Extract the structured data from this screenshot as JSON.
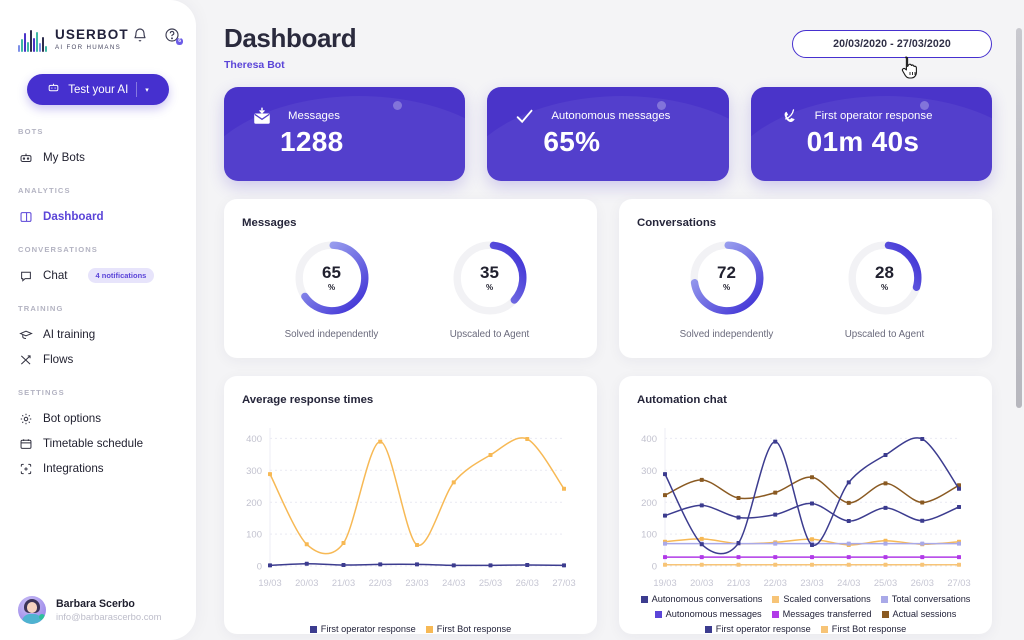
{
  "brand": {
    "name": "USERBOT",
    "tagline": "AI FOR HUMANS"
  },
  "header_icons": [
    {
      "name": "bell-icon",
      "badge": ""
    },
    {
      "name": "help-icon",
      "badge": "6"
    }
  ],
  "test_button": {
    "label": "Test your AI",
    "caret": "▾",
    "icon": "bot-icon"
  },
  "sidebar": {
    "groups": [
      {
        "title": "BOTS",
        "items": [
          {
            "label": "My Bots",
            "icon": "robot-icon",
            "active": false,
            "badge": ""
          }
        ]
      },
      {
        "title": "ANALYTICS",
        "items": [
          {
            "label": "Dashboard",
            "icon": "layout-icon",
            "active": true,
            "badge": ""
          }
        ]
      },
      {
        "title": "CONVERSATIONS",
        "items": [
          {
            "label": "Chat",
            "icon": "chat-bubble-icon",
            "active": false,
            "badge": "4 notifications"
          }
        ]
      },
      {
        "title": "TRAINING",
        "items": [
          {
            "label": "AI training",
            "icon": "graduation-cap-icon",
            "active": false,
            "badge": ""
          },
          {
            "label": "Flows",
            "icon": "flow-arrows-icon",
            "active": false,
            "badge": ""
          }
        ]
      },
      {
        "title": "SETTINGS",
        "items": [
          {
            "label": "Bot options",
            "icon": "gear-icon",
            "active": false,
            "badge": ""
          },
          {
            "label": "Timetable schedule",
            "icon": "calendar-icon",
            "active": false,
            "badge": ""
          },
          {
            "label": "Integrations",
            "icon": "puzzle-plus-icon",
            "active": false,
            "badge": ""
          }
        ]
      }
    ]
  },
  "user": {
    "name": "Barbara Scerbo",
    "email": "info@barbarascerbo.com",
    "avatar": "user-avatar"
  },
  "page": {
    "title": "Dashboard",
    "subtitle": "Theresa Bot"
  },
  "date_range": {
    "value": "20/03/2020 - 27/03/2020"
  },
  "kpis": [
    {
      "label": "Messages",
      "value": "1288",
      "icon": "mail-inbox-icon"
    },
    {
      "label": "Autonomous messages",
      "value": "65%",
      "icon": "check-icon"
    },
    {
      "label": "First operator response",
      "value": "01m 40s",
      "icon": "phone-icon"
    }
  ],
  "donut_panels": [
    {
      "title": "Messages",
      "donuts": [
        {
          "value": 65,
          "unit": "%",
          "caption": "Solved independently"
        },
        {
          "value": 35,
          "unit": "%",
          "caption": "Upscaled to Agent"
        }
      ]
    },
    {
      "title": "Conversations",
      "donuts": [
        {
          "value": 72,
          "unit": "%",
          "caption": "Solved independently"
        },
        {
          "value": 28,
          "unit": "%",
          "caption": "Upscaled to Agent"
        }
      ]
    }
  ],
  "colors": {
    "accent": "#4630cf",
    "accent_light": "#5b45d8",
    "card": "#4a34c9",
    "donut_track": "#f1f1f4",
    "donut_from": "#4438d6",
    "donut_to": "#a8b4f2",
    "orange": "#f7b955",
    "indigo": "#3c3c8f",
    "brown": "#8a5a22",
    "magenta": "#b13ae8",
    "periwinkle": "#a9a9e8"
  },
  "chart_data": [
    {
      "type": "line",
      "title": "Average response times",
      "xlabel": "",
      "ylabel": "",
      "ylim": [
        0,
        420
      ],
      "yticks": [
        0,
        100,
        200,
        300,
        400
      ],
      "grid": true,
      "legend_position": "bottom",
      "x": [
        "19/03",
        "20/03",
        "21/03",
        "22/03",
        "23/03",
        "24/03",
        "25/03",
        "26/03",
        "27/03"
      ],
      "series": [
        {
          "name": "First Bot response",
          "color": "#f7b955",
          "values": [
            288,
            68,
            72,
            390,
            66,
            262,
            348,
            398,
            242
          ]
        },
        {
          "name": "First operator response",
          "color": "#3c3c8f",
          "values": [
            2,
            7,
            3,
            5,
            5,
            2,
            2,
            3,
            2
          ]
        }
      ],
      "legend": [
        {
          "label": "First operator response",
          "color": "#3c3c8f"
        },
        {
          "label": "First Bot response",
          "color": "#f7b955"
        }
      ]
    },
    {
      "type": "line",
      "title": "Automation chat",
      "xlabel": "",
      "ylabel": "",
      "ylim": [
        0,
        420
      ],
      "yticks": [
        0,
        100,
        200,
        300,
        400
      ],
      "grid": true,
      "legend_position": "bottom",
      "x": [
        "19/03",
        "20/03",
        "21/03",
        "22/03",
        "23/03",
        "24/03",
        "25/03",
        "26/03",
        "27/03"
      ],
      "series": [
        {
          "name": "First operator response",
          "color": "#3c3c8f",
          "values": [
            288,
            68,
            72,
            390,
            66,
            262,
            348,
            398,
            242
          ]
        },
        {
          "name": "Actual sessions",
          "color": "#8a5a22",
          "values": [
            222,
            270,
            213,
            230,
            278,
            198,
            259,
            199,
            253
          ]
        },
        {
          "name": "Autonomous conversations",
          "color": "#3c3c8f",
          "values": [
            158,
            190,
            152,
            161,
            196,
            141,
            182,
            142,
            185
          ]
        },
        {
          "name": "Total conversations",
          "color": "#a9a9e8",
          "values": [
            70,
            70,
            70,
            70,
            70,
            70,
            70,
            70,
            70
          ]
        },
        {
          "name": "Scaled conversations",
          "color": "#f7b955",
          "values": [
            76,
            85,
            70,
            74,
            84,
            66,
            79,
            68,
            76
          ]
        },
        {
          "name": "Messages transferred",
          "color": "#b13ae8",
          "values": [
            28,
            28,
            28,
            28,
            28,
            28,
            28,
            28,
            28
          ]
        },
        {
          "name": "First Bot response",
          "color": "#f7c477",
          "values": [
            4,
            4,
            4,
            4,
            4,
            4,
            4,
            4,
            4
          ]
        }
      ],
      "legend": [
        {
          "label": "Autonomous conversations",
          "color": "#3c3c8f"
        },
        {
          "label": "Scaled conversations",
          "color": "#f7c477"
        },
        {
          "label": "Total conversations",
          "color": "#a9a9e8"
        },
        {
          "label": "Autonomous messages",
          "color": "#5b45d8"
        },
        {
          "label": "Messages transferred",
          "color": "#b13ae8"
        },
        {
          "label": "Actual sessions",
          "color": "#8a5a22"
        },
        {
          "label": "First operator response",
          "color": "#3c3c8f"
        },
        {
          "label": "First Bot response",
          "color": "#f7c477"
        }
      ]
    }
  ]
}
